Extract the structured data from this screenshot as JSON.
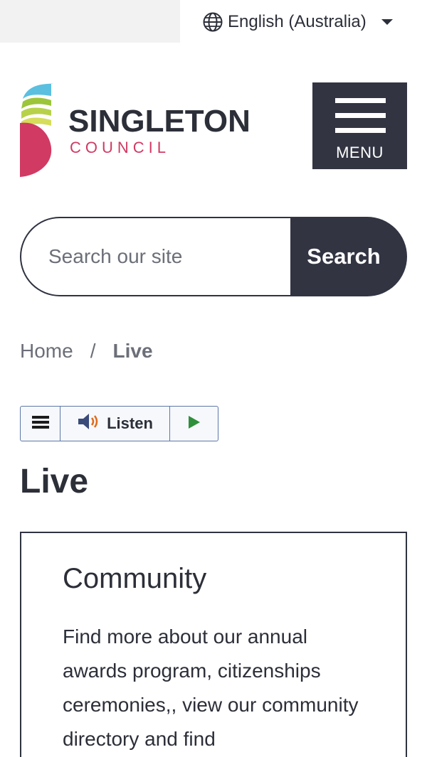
{
  "language": {
    "selected": "English (Australia)"
  },
  "header": {
    "logo_title": "SINGLETON",
    "logo_subtitle": "COUNCIL",
    "menu_label": "MENU"
  },
  "search": {
    "placeholder": "Search our site",
    "button_label": "Search"
  },
  "breadcrumb": {
    "home": "Home",
    "separator": "/",
    "current": "Live"
  },
  "listen_toolbar": {
    "listen_label": "Listen"
  },
  "page": {
    "title": "Live"
  },
  "cards": [
    {
      "title": "Community",
      "text": "Find more about our annual awards program, citizenships ceremonies,, view our community directory and find"
    }
  ],
  "colors": {
    "dark": "#323442",
    "brand_pink": "#d13a63",
    "brand_green": "#9cc53a",
    "brand_blue": "#5bbfe0"
  }
}
